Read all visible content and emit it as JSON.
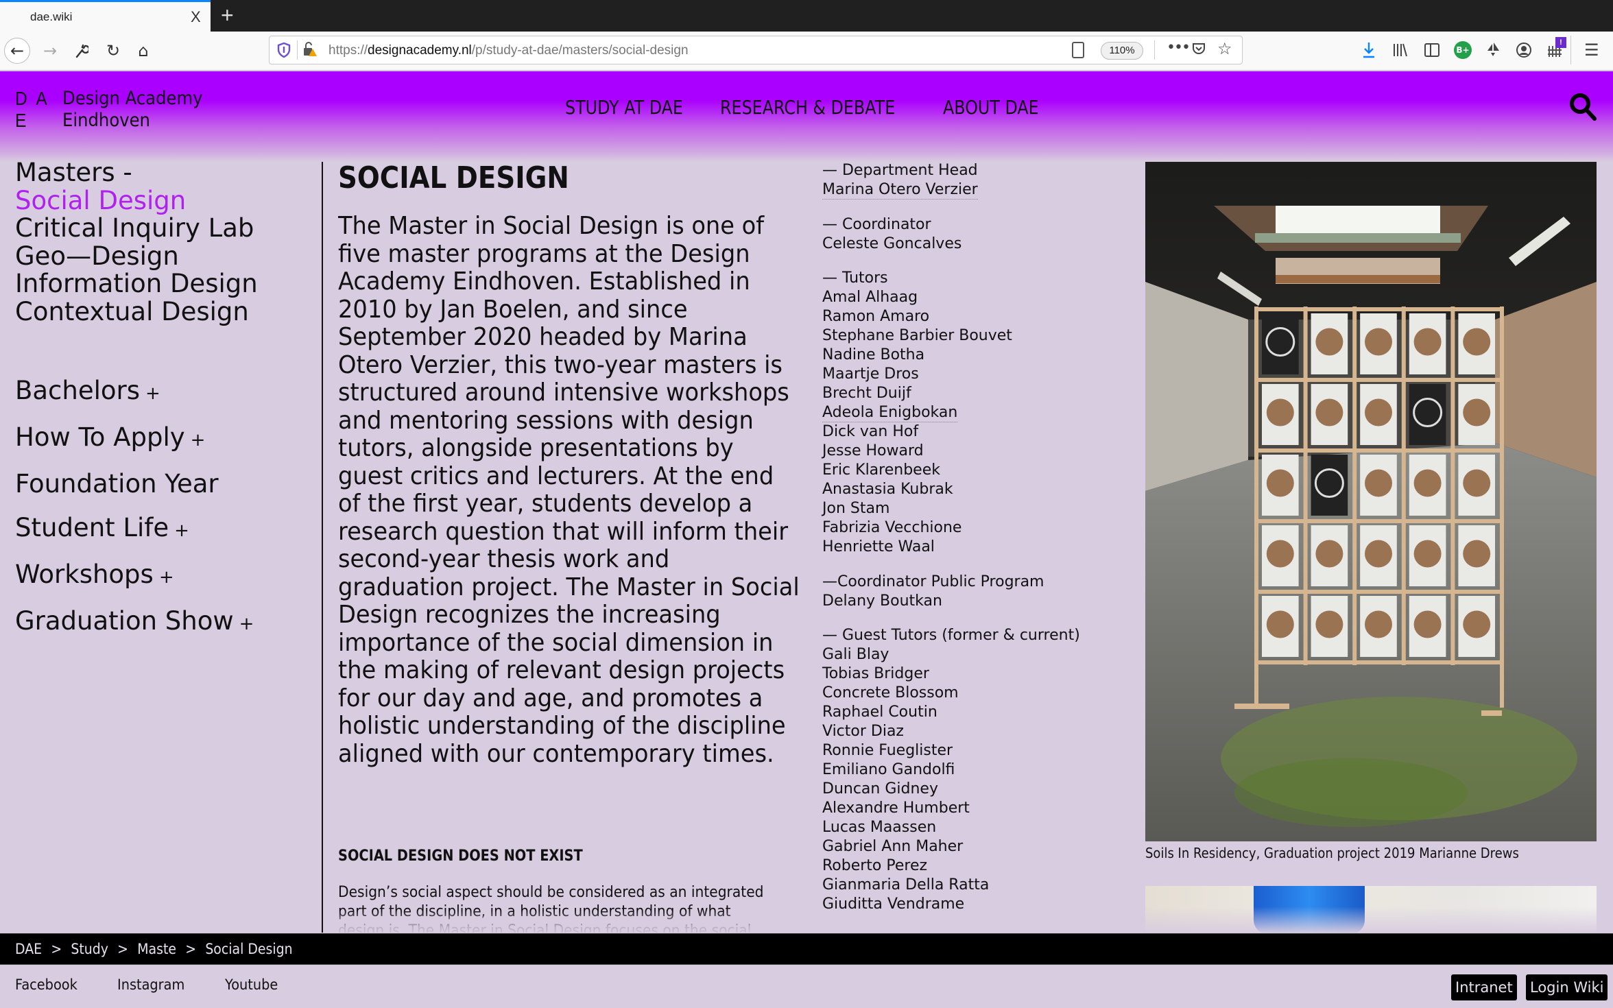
{
  "browser": {
    "tab_title": "dae.wiki",
    "tab_close": "X",
    "new_tab": "+",
    "url_host_prefix": "https://",
    "url_host": "designacademy.nl",
    "url_path": "/p/study-at-dae/masters/social-design",
    "zoom_level": "110%",
    "extension_badge": "!",
    "extension_label": "B+",
    "icons": {
      "back": "←",
      "forward": "→",
      "tools": "wrench",
      "reload": "↻",
      "home": "⌂",
      "more": "•••",
      "star": "☆",
      "menu": "☰",
      "download": "⤓",
      "library": "|||\\"
    }
  },
  "header": {
    "logo_mark_line1": "D A",
    "logo_mark_line2": "E",
    "logo_text_line1": "Design Academy",
    "logo_text_line2": "Eindhoven",
    "nav": [
      {
        "label": "STUDY AT DAE"
      },
      {
        "label": "RESEARCH & DEBATE"
      },
      {
        "label": "ABOUT DAE"
      }
    ]
  },
  "sidebar": {
    "masters_label": "Masters -",
    "masters": [
      {
        "label": "Social Design",
        "current": true
      },
      {
        "label": "Critical Inquiry Lab"
      },
      {
        "label": "Geo—Design"
      },
      {
        "label": "Information Design"
      },
      {
        "label": "Contextual Design"
      }
    ],
    "sections": [
      {
        "label": "Bachelors",
        "expand": "+"
      },
      {
        "label": "How To Apply",
        "expand": "+"
      },
      {
        "label": "Foundation Year",
        "expand": ""
      },
      {
        "label": "Student Life",
        "expand": "+"
      },
      {
        "label": "Workshops",
        "expand": "+"
      },
      {
        "label": "Graduation Show",
        "expand": "+"
      }
    ]
  },
  "main": {
    "title": "SOCIAL DESIGN",
    "intro": "The Master in Social Design is one of five master programs at the Design Academy Eindhoven. Established in 2010 by Jan Boelen, and since September 2020 headed by Marina Otero Verzier, this two-year masters is structured around intensive workshops and mentoring sessions with design tutors, alongside presentations by guest critics and lecturers. At the end of the first year, students develop a research question that will inform their second-year thesis work and graduation project. The Master in Social Design recognizes the increasing importance of the social dimension in the making of relevant design projects for our day and age, and promotes a holistic understanding of the discipline aligned with our contemporary times.",
    "subheading": "SOCIAL DESIGN DOES NOT EXIST",
    "body": "Design’s social aspect should be considered as an integrated part of the discipline, in a holistic understanding of what design is. The Master in Social Design focuses on the social"
  },
  "staff": {
    "groups": [
      {
        "heading": "— Department Head",
        "names": [
          {
            "name": "Marina Otero Verzier",
            "linked": true
          }
        ]
      },
      {
        "heading": "— Coordinator",
        "names": [
          {
            "name": "Celeste Goncalves"
          }
        ]
      },
      {
        "heading": "— Tutors",
        "names": [
          {
            "name": "Amal Alhaag"
          },
          {
            "name": "Ramon Amaro"
          },
          {
            "name": "Stephane Barbier Bouvet"
          },
          {
            "name": "Nadine Botha"
          },
          {
            "name": "Maartje Dros"
          },
          {
            "name": "Brecht Duijf"
          },
          {
            "name": "Adeola Enigbokan",
            "linked": true
          },
          {
            "name": "Dick van Hof"
          },
          {
            "name": "Jesse Howard"
          },
          {
            "name": "Eric Klarenbeek"
          },
          {
            "name": "Anastasia Kubrak"
          },
          {
            "name": "Jon Stam"
          },
          {
            "name": "Fabrizia Vecchione"
          },
          {
            "name": "Henriette Waal"
          }
        ]
      },
      {
        "heading": "—Coordinator Public Program",
        "names": [
          {
            "name": "Delany Boutkan"
          }
        ]
      },
      {
        "heading": "— Guest Tutors (former & current)",
        "names": [
          {
            "name": "Gali Blay"
          },
          {
            "name": "Tobias Bridger"
          },
          {
            "name": "Concrete Blossom"
          },
          {
            "name": "Raphael Coutin"
          },
          {
            "name": "Victor Diaz"
          },
          {
            "name": "Ronnie Fueglister"
          },
          {
            "name": "Emiliano Gandolfi"
          },
          {
            "name": "Duncan Gidney"
          },
          {
            "name": "Alexandre Humbert"
          },
          {
            "name": "Lucas Maassen"
          },
          {
            "name": "Gabriel Ann Maher"
          },
          {
            "name": "Roberto Perez"
          },
          {
            "name": "Gianmaria Della Ratta"
          },
          {
            "name": "Giuditta Vendrame"
          }
        ]
      }
    ]
  },
  "images": {
    "photo1_caption": "Soils In Residency, Graduation project 2019 Marianne Drews"
  },
  "footer": {
    "breadcrumb": [
      {
        "label": "DAE"
      },
      {
        "label": "Study"
      },
      {
        "label": "Maste"
      },
      {
        "label": "Social Design"
      }
    ],
    "breadcrumb_sep": ">",
    "social_links": [
      {
        "label": "Facebook"
      },
      {
        "label": "Instagram"
      },
      {
        "label": "Youtube"
      }
    ],
    "intranet_label": "Intranet",
    "login_label": "Login Wiki"
  },
  "colors": {
    "accent": "#aa00ff",
    "current_link": "#b020f0",
    "page_bg": "#d8cce0",
    "footer_bar": "#000000"
  }
}
